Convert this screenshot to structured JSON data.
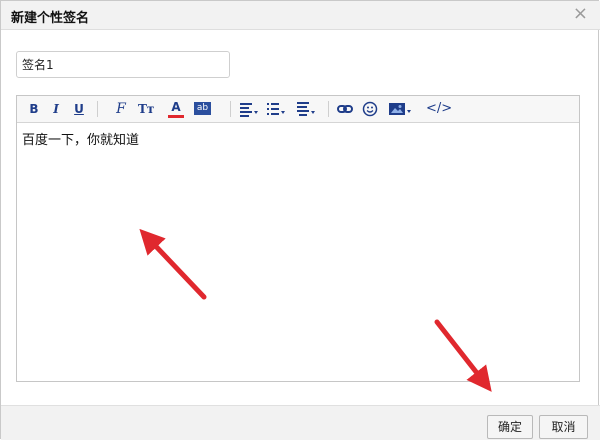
{
  "dialog": {
    "title": "新建个性签名",
    "close_glyph": "×"
  },
  "name_field": {
    "value": "签名1"
  },
  "editor": {
    "content": "百度一下，你就知道",
    "toolbar": {
      "bold": "B",
      "italic": "I",
      "underline": "U",
      "font_family": "F",
      "font_size": "Tт",
      "font_color": "A",
      "background_color": "ab",
      "html_source": "</>"
    }
  },
  "footer": {
    "confirm_label": "确定",
    "cancel_label": "取消"
  },
  "annotation": {
    "arrow_color": "#e0282e"
  }
}
